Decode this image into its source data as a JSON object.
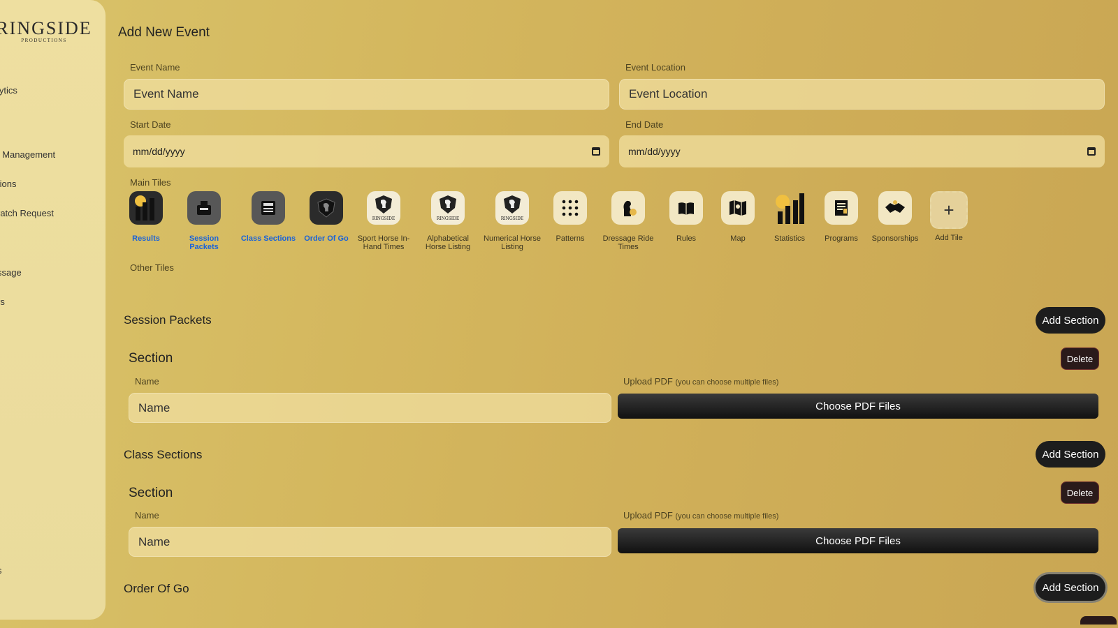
{
  "sidebar": {
    "logo_main": "RINGSIDE",
    "logo_sub": "PRODUCTIONS",
    "items": [
      {
        "label": "lytics"
      },
      {
        "label": "t Management"
      },
      {
        "label": "tions"
      },
      {
        "label": "ratch Request"
      },
      {
        "label": "ssage"
      },
      {
        "label": "rs"
      },
      {
        "label": "s"
      },
      {
        "label": ":"
      }
    ]
  },
  "page": {
    "title": "Add New Event"
  },
  "form": {
    "event_name": {
      "label": "Event Name",
      "placeholder": "Event Name"
    },
    "event_location": {
      "label": "Event Location",
      "placeholder": "Event Location"
    },
    "start_date": {
      "label": "Start Date",
      "value": "mm/dd/yyyy"
    },
    "end_date": {
      "label": "End Date",
      "value": "mm/dd/yyyy"
    },
    "main_tiles_label": "Main Tiles",
    "other_tiles_label": "Other Tiles"
  },
  "tiles": [
    {
      "label": "Results",
      "selected": true,
      "icon": "bar-chart-icon"
    },
    {
      "label": "Session Packets",
      "selected": true,
      "icon": "packet-icon"
    },
    {
      "label": "Class Sections",
      "selected": true,
      "icon": "list-icon"
    },
    {
      "label": "Order Of Go",
      "selected": true,
      "icon": "horse-crest-icon"
    },
    {
      "label": "Sport Horse In-Hand Times",
      "selected": false,
      "icon": "ringside-crest-icon"
    },
    {
      "label": "Alphabetical Horse Listing",
      "selected": false,
      "icon": "ringside-crest-icon"
    },
    {
      "label": "Numerical Horse Listing",
      "selected": false,
      "icon": "ringside-crest-icon"
    },
    {
      "label": "Patterns",
      "selected": false,
      "icon": "dot-grid-icon"
    },
    {
      "label": "Dressage Ride Times",
      "selected": false,
      "icon": "horse-head-icon"
    },
    {
      "label": "Rules",
      "selected": false,
      "icon": "book-icon"
    },
    {
      "label": "Map",
      "selected": false,
      "icon": "map-icon"
    },
    {
      "label": "Statistics",
      "selected": false,
      "icon": "statistics-icon"
    },
    {
      "label": "Programs",
      "selected": false,
      "icon": "document-icon"
    },
    {
      "label": "Sponsorships",
      "selected": false,
      "icon": "handshake-icon"
    },
    {
      "label": "Add Tile",
      "selected": false,
      "icon": "plus-icon"
    }
  ],
  "sections": [
    {
      "title": "Session Packets",
      "add_label": "Add Section",
      "section_title": "Section",
      "delete_label": "Delete",
      "name_label": "Name",
      "name_placeholder": "Name",
      "upload_label": "Upload PDF",
      "upload_hint": "(you can choose multiple files)",
      "upload_button": "Choose PDF Files"
    },
    {
      "title": "Class Sections",
      "add_label": "Add Section",
      "section_title": "Section",
      "delete_label": "Delete",
      "name_label": "Name",
      "name_placeholder": "Name",
      "upload_label": "Upload PDF",
      "upload_hint": "(you can choose multiple files)",
      "upload_button": "Choose PDF Files"
    },
    {
      "title": "Order Of Go",
      "add_label": "Add Section"
    }
  ],
  "colors": {
    "accent_selected": "#1a63d8",
    "button_dark": "#1d1d1d",
    "sidebar_bg": "#eedfa0"
  }
}
